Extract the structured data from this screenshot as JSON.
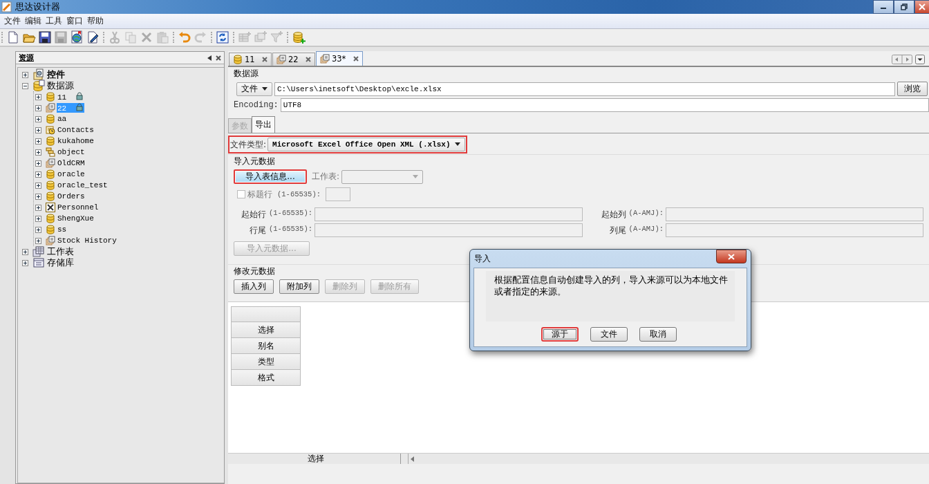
{
  "window": {
    "title": "思达设计器"
  },
  "menu": [
    "文件",
    "编辑",
    "工具",
    "窗口",
    "帮助"
  ],
  "toolbar": {
    "groups": [
      [
        {
          "kind": "new",
          "disabled": false
        },
        {
          "kind": "open",
          "disabled": false
        },
        {
          "kind": "save",
          "disabled": false
        },
        {
          "kind": "save_all",
          "disabled": true
        },
        {
          "kind": "publish",
          "disabled": false
        },
        {
          "kind": "edit",
          "disabled": false
        }
      ],
      [
        {
          "kind": "cut",
          "disabled": true
        },
        {
          "kind": "copy",
          "disabled": true
        },
        {
          "kind": "delete",
          "disabled": true
        },
        {
          "kind": "paste",
          "disabled": true
        }
      ],
      [
        {
          "kind": "undo",
          "disabled": false
        },
        {
          "kind": "redo",
          "disabled": true
        }
      ],
      [
        {
          "kind": "refresh",
          "disabled": false
        }
      ],
      [
        {
          "kind": "add_table",
          "disabled": true
        },
        {
          "kind": "add_query",
          "disabled": true
        },
        {
          "kind": "add_filter",
          "disabled": true
        }
      ],
      [
        {
          "kind": "add_datasource",
          "disabled": false
        }
      ]
    ]
  },
  "resources": {
    "title": "资源",
    "tree": [
      {
        "label": "控件",
        "kind": "components",
        "bold": true,
        "expanded": false,
        "selected": false
      },
      {
        "label": "数据源",
        "kind": "datasources",
        "bold": false,
        "expanded": true,
        "selected": false,
        "children": [
          {
            "label": "11",
            "kind": "database",
            "expanded": false,
            "selected": false,
            "locked": true
          },
          {
            "label": "22",
            "kind": "query",
            "expanded": false,
            "selected": true,
            "locked": true
          },
          {
            "label": "aa",
            "kind": "database",
            "expanded": false,
            "selected": false,
            "locked": false
          },
          {
            "label": "Contacts",
            "kind": "webservice",
            "expanded": false,
            "selected": false,
            "locked": false
          },
          {
            "label": "kukahome",
            "kind": "database",
            "expanded": false,
            "selected": false,
            "locked": false
          },
          {
            "label": "object",
            "kind": "object",
            "expanded": false,
            "selected": false,
            "locked": false
          },
          {
            "label": "OldCRM",
            "kind": "query",
            "expanded": false,
            "selected": false,
            "locked": false
          },
          {
            "label": "oracle",
            "kind": "database",
            "expanded": false,
            "selected": false,
            "locked": false
          },
          {
            "label": "oracle_test",
            "kind": "database",
            "expanded": false,
            "selected": false,
            "locked": false
          },
          {
            "label": "Orders",
            "kind": "database",
            "expanded": false,
            "selected": false,
            "locked": false
          },
          {
            "label": "Personnel",
            "kind": "excel",
            "expanded": false,
            "selected": false,
            "locked": false
          },
          {
            "label": "ShengXue",
            "kind": "database",
            "expanded": false,
            "selected": false,
            "locked": false
          },
          {
            "label": "ss",
            "kind": "database",
            "expanded": false,
            "selected": false,
            "locked": false
          },
          {
            "label": "Stock History",
            "kind": "query",
            "expanded": false,
            "selected": false,
            "locked": false
          }
        ]
      },
      {
        "label": "工作表",
        "kind": "worksheets",
        "bold": false,
        "expanded": false,
        "selected": false
      },
      {
        "label": "存储库",
        "kind": "repository",
        "bold": false,
        "expanded": false,
        "selected": false
      }
    ]
  },
  "editor_tabs": [
    {
      "label": "11",
      "kind": "database",
      "selected": false
    },
    {
      "label": "22",
      "kind": "query",
      "selected": false
    },
    {
      "label": "33*",
      "kind": "query",
      "selected": true
    }
  ],
  "datasource": {
    "title": "数据源",
    "source_type": "文件",
    "path": "C:\\Users\\inetsoft\\Desktop\\excle.xlsx",
    "browse": "浏览",
    "encoding_label": "Encoding:",
    "encoding": "UTF8"
  },
  "sub_tabs": [
    {
      "label": "参数",
      "selected": false,
      "disabled": true
    },
    {
      "label": "导出",
      "selected": true,
      "disabled": false
    }
  ],
  "file_type": {
    "label": "文件类型:",
    "value": "Microsoft Excel Office Open XML (.xlsx)",
    "highlighted": true
  },
  "import_metadata": {
    "title": "导入元数据",
    "import_button": {
      "label": "导入表信息...",
      "highlighted": true
    },
    "sheet_select": {
      "label": "工作表:",
      "disabled": true
    },
    "header_row": {
      "label": "标题行",
      "hint": "(1-65535):",
      "checked": false,
      "disabled": true
    },
    "fields": [
      {
        "label": "起始行",
        "hint": "(1-65535):"
      },
      {
        "label": "起始列",
        "hint": "(A-AMJ):"
      },
      {
        "label": "行尾",
        "hint": "(1-65535):"
      },
      {
        "label": "列尾",
        "hint": "(A-AMJ):"
      }
    ],
    "import_data_button": {
      "label": "导入元数据...",
      "disabled": true
    }
  },
  "modify_metadata": {
    "title": "修改元数据",
    "buttons": [
      {
        "label": "插入列",
        "disabled": false
      },
      {
        "label": "附加列",
        "disabled": false
      },
      {
        "label": "删除列",
        "disabled": true
      },
      {
        "label": "删除所有",
        "disabled": true
      }
    ]
  },
  "grid": {
    "row_headers": [
      "选择",
      "别名",
      "类型",
      "格式"
    ]
  },
  "bottom_bar": {
    "column_header": "选择"
  },
  "dialog": {
    "title": "导入",
    "message": "根据配置信息自动创建导入的列，导入来源可以为本地文件或者指定的来源。",
    "buttons": [
      {
        "label": "源于",
        "highlighted": true
      },
      {
        "label": "文件",
        "highlighted": false
      },
      {
        "label": "取消",
        "highlighted": false
      }
    ]
  }
}
